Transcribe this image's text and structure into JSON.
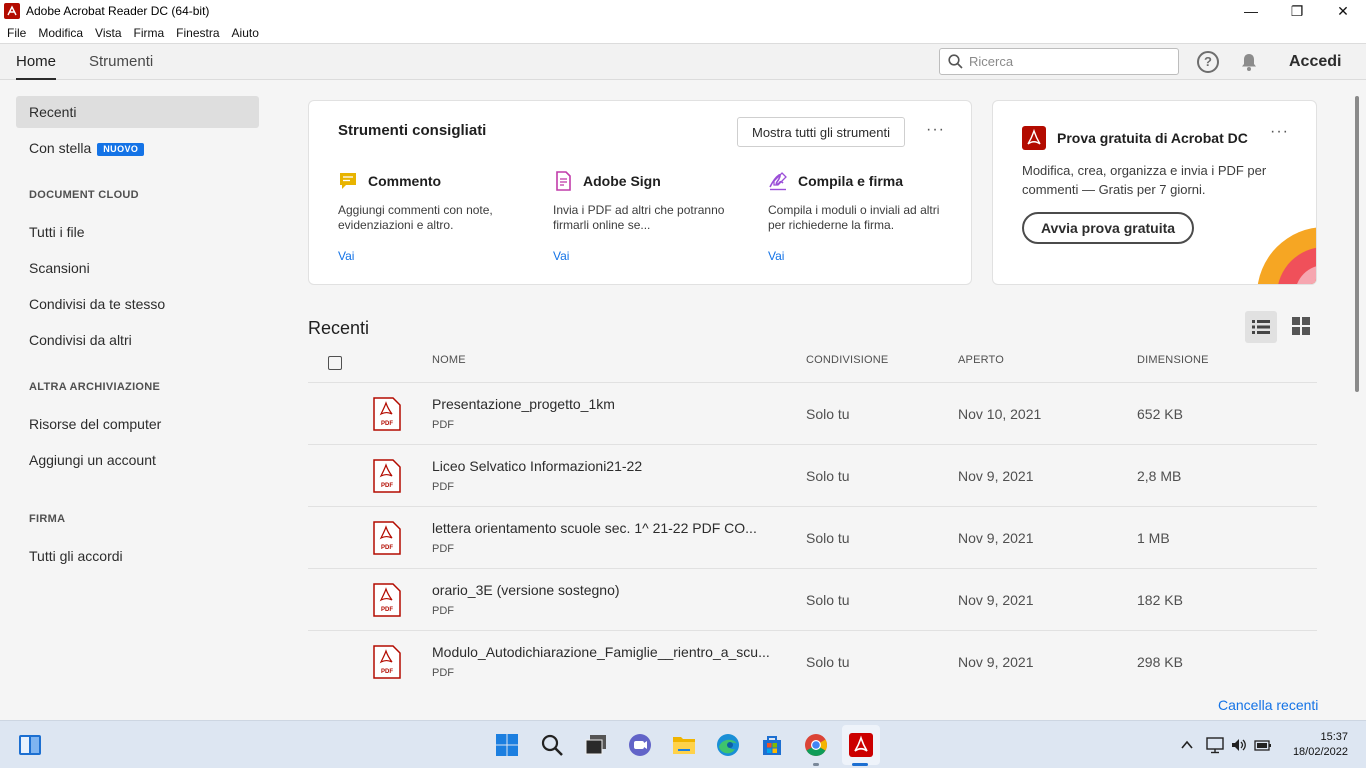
{
  "window": {
    "title": "Adobe Acrobat Reader DC (64-bit)",
    "minimize": "—",
    "maximize": "❐",
    "close": "✕"
  },
  "menu": [
    "File",
    "Modifica",
    "Vista",
    "Firma",
    "Finestra",
    "Aiuto"
  ],
  "nav": {
    "tab_home": "Home",
    "tab_tools": "Strumenti",
    "search_placeholder": "Ricerca",
    "help": "?",
    "login": "Accedi"
  },
  "sidebar": {
    "recent": "Recenti",
    "starred": "Con stella",
    "new_badge": "NUOVO",
    "doc_cloud_header": "DOCUMENT CLOUD",
    "all_files": "Tutti i file",
    "scans": "Scansioni",
    "shared_by_you": "Condivisi da te stesso",
    "shared_by_others": "Condivisi da altri",
    "other_storage_header": "ALTRA ARCHIVIAZIONE",
    "computer": "Risorse del computer",
    "add_account": "Aggiungi un account",
    "sign_header": "FIRMA",
    "all_agreements": "Tutti gli accordi"
  },
  "tools_card": {
    "title": "Strumenti consigliati",
    "show_all": "Mostra tutti gli strumenti",
    "more": "···",
    "tools": [
      {
        "name": "Commento",
        "desc": "Aggiungi commenti con note, evidenziazioni e altro.",
        "link": "Vai",
        "icon": "comment-icon",
        "color": "#e8b400"
      },
      {
        "name": "Adobe Sign",
        "desc": "Invia i PDF ad altri che potranno firmarli online se...",
        "link": "Vai",
        "icon": "adobe-sign-icon",
        "color": "#c13caa"
      },
      {
        "name": "Compila e firma",
        "desc": "Compila i moduli o inviali ad altri per richiederne la firma.",
        "link": "Vai",
        "icon": "fill-sign-icon",
        "color": "#9b4fd8"
      }
    ]
  },
  "trial_card": {
    "title": "Prova gratuita di Acrobat DC",
    "desc": "Modifica, crea, organizza e invia i PDF per commenti — Gratis per 7 giorni.",
    "button": "Avvia prova gratuita",
    "more": "···"
  },
  "recent": {
    "title": "Recenti",
    "columns": {
      "name": "NOME",
      "sharing": "CONDIVISIONE",
      "opened": "APERTO",
      "size": "DIMENSIONE"
    },
    "files": [
      {
        "name": "Presentazione_progetto_1km",
        "type": "PDF",
        "sharing": "Solo tu",
        "opened": "Nov 10, 2021",
        "size": "652 KB"
      },
      {
        "name": "Liceo Selvatico Informazioni21-22",
        "type": "PDF",
        "sharing": "Solo tu",
        "opened": "Nov 9, 2021",
        "size": "2,8 MB"
      },
      {
        "name": "lettera orientamento scuole sec. 1^ 21-22 PDF CO...",
        "type": "PDF",
        "sharing": "Solo tu",
        "opened": "Nov 9, 2021",
        "size": "1 MB"
      },
      {
        "name": "orario_3E (versione sostegno)",
        "type": "PDF",
        "sharing": "Solo tu",
        "opened": "Nov 9, 2021",
        "size": "182 KB"
      },
      {
        "name": "Modulo_Autodichiarazione_Famiglie__rientro_a_scu...",
        "type": "PDF",
        "sharing": "Solo tu",
        "opened": "Nov 9, 2021",
        "size": "298 KB"
      }
    ],
    "clear": "Cancella recenti"
  },
  "taskbar": {
    "time": "15:37",
    "date": "18/02/2022"
  },
  "colors": {
    "accent": "#1473e6",
    "acrobat_red": "#b30b00"
  }
}
